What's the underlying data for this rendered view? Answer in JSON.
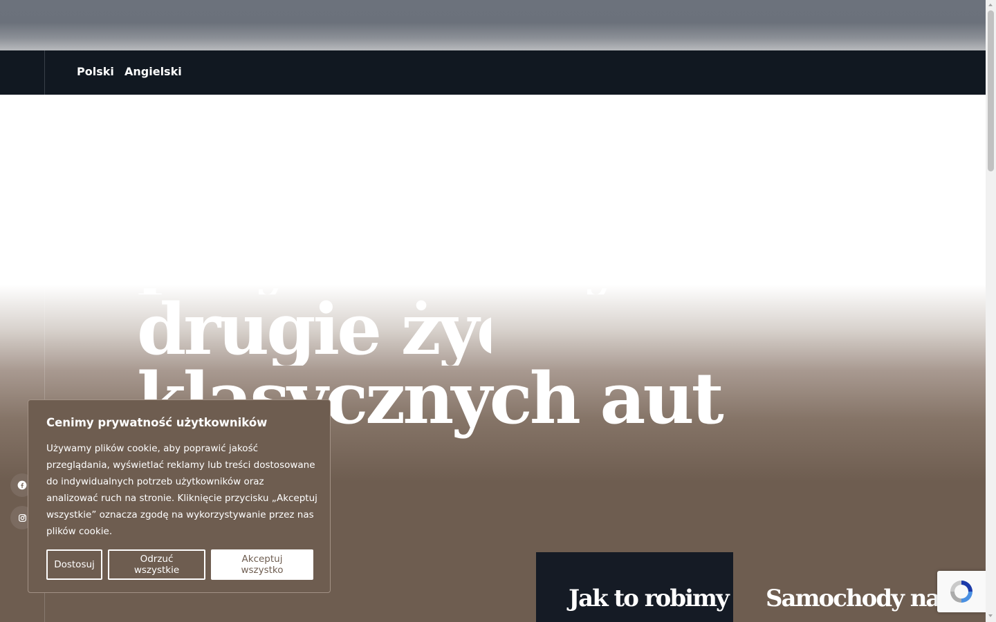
{
  "nav": {
    "links": [
      {
        "label": "Polski"
      },
      {
        "label": "Angielski"
      }
    ]
  },
  "hero": {
    "lines": [
      "przywracamy",
      "drugie życie",
      "klasycznych aut"
    ]
  },
  "social": {
    "icons": [
      "facebook-icon",
      "instagram-icon"
    ]
  },
  "cards": {
    "dark_title": "Jak to robimy",
    "light_title": "Samochody na sprzedaż"
  },
  "cookie": {
    "title": "Cenimy prywatność użytkowników",
    "text": "Używamy plików cookie, aby poprawić jakość przeglądania, wyświetlać reklamy lub treści dostosowane do indywidualnych potrzeb użytkowników oraz analizować ruch na stronie. Kliknięcie przycisku „Akceptuj wszystkie” oznacza zgodę na wykorzystywanie przez nas plików cookie.",
    "buttons": {
      "customize": "Dostosuj",
      "reject_all": "Odrzuć wszystkie",
      "accept_all": "Akceptuj wszystko"
    }
  },
  "colors": {
    "nav_bg": "#111821",
    "hero_brown": "#6e5d50",
    "card_dark": "#151b25"
  }
}
